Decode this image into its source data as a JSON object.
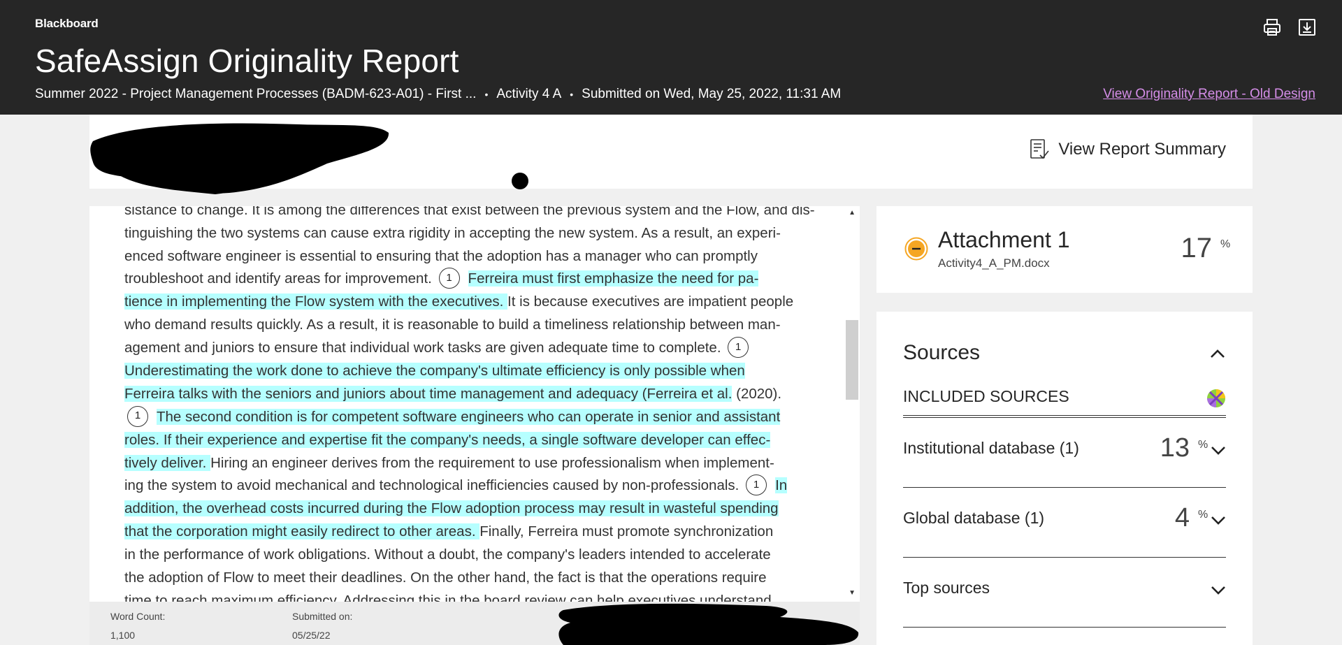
{
  "header": {
    "brand": "Blackboard",
    "title": "SafeAssign Originality Report",
    "course": "Summer 2022 - Project Management Processes (BADM-623-A01) - First ...",
    "activity": "Activity 4 A",
    "submitted": "Submitted on Wed, May 25, 2022, 11:31 AM",
    "old_design_link": "View Originality Report - Old Design",
    "separator": "•"
  },
  "toolbar": {
    "view_summary": "View Report Summary"
  },
  "document": {
    "marker_label": "1",
    "lines": [
      {
        "segments": [
          {
            "text": "sistance to change. It is among the differences that exist between the previous system and the Flow, and dis-",
            "hl": false
          }
        ]
      },
      {
        "segments": [
          {
            "text": "tinguishing the two systems can cause extra rigidity in accepting the new system. As a result, an experi-",
            "hl": false
          }
        ]
      },
      {
        "segments": [
          {
            "text": "enced software engineer is essential to ensuring that the adoption has a manager who can promptly",
            "hl": false
          }
        ]
      },
      {
        "segments": [
          {
            "text": "troubleshoot and identify areas for improvement. ",
            "hl": false
          },
          {
            "marker": true
          },
          {
            "text": "Ferreira must first emphasize the need for pa-",
            "hl": true
          }
        ]
      },
      {
        "segments": [
          {
            "text": "tience in implementing the Flow system with the executives. ",
            "hl": true
          },
          {
            "text": "It is because executives are impatient people",
            "hl": false
          }
        ]
      },
      {
        "segments": [
          {
            "text": "who demand results quickly. As a result, it is reasonable to build a timeliness relationship between man-",
            "hl": false
          }
        ]
      },
      {
        "segments": [
          {
            "text": "agement and juniors to ensure that individual work tasks are given adequate time to complete. ",
            "hl": false
          },
          {
            "marker": true
          }
        ]
      },
      {
        "segments": [
          {
            "text": "Underestimating the work done to achieve the company's ultimate efficiency is only possible when",
            "hl": true
          }
        ]
      },
      {
        "segments": [
          {
            "text": "Ferreira talks with the seniors and juniors about time management and adequacy (Ferreira et al.",
            "hl": true
          },
          {
            "text": " (2020).",
            "hl": false
          }
        ]
      },
      {
        "segments": [
          {
            "marker": true
          },
          {
            "text": "The second condition is for competent software engineers who can operate in senior and assistant",
            "hl": true
          }
        ]
      },
      {
        "segments": [
          {
            "text": "roles. If their experience and expertise fit the company's needs, a single software developer can effec-",
            "hl": true
          }
        ]
      },
      {
        "segments": [
          {
            "text": "tively deliver. ",
            "hl": true
          },
          {
            "text": "Hiring an engineer derives from the requirement to use professionalism when implement-",
            "hl": false
          }
        ]
      },
      {
        "segments": [
          {
            "text": "ing the system to avoid mechanical and technological inefficiencies caused by non-professionals. ",
            "hl": false
          },
          {
            "marker": true
          },
          {
            "text": "In",
            "hl": true
          }
        ]
      },
      {
        "segments": [
          {
            "text": "addition, the overhead costs incurred during the Flow adoption process may result in wasteful spending",
            "hl": true
          }
        ]
      },
      {
        "segments": [
          {
            "text": "that the corporation might easily redirect to other areas. ",
            "hl": true
          },
          {
            "text": "Finally, Ferreira must promote synchronization",
            "hl": false
          }
        ]
      },
      {
        "segments": [
          {
            "text": "in the performance of work obligations. Without a doubt, the company's leaders intended to accelerate",
            "hl": false
          }
        ]
      },
      {
        "segments": [
          {
            "text": "the adoption of Flow to meet their deadlines. On the other hand, the fact is that the operations require",
            "hl": false
          }
        ]
      },
      {
        "segments": [
          {
            "text": "time to reach maximum efficiency. Addressing this in the board review can help executives understand",
            "hl": false
          }
        ]
      }
    ]
  },
  "footer": {
    "word_count_label": "Word Count:",
    "word_count_value": "1,100",
    "submitted_label": "Submitted on:",
    "submitted_value": "05/25/22"
  },
  "attachment": {
    "title": "Attachment 1",
    "filename": "Activity4_A_PM.docx",
    "percent": "17",
    "pct_sign": "%"
  },
  "sources": {
    "title": "Sources",
    "included_label": "INCLUDED SOURCES",
    "rows": [
      {
        "name": "Institutional database (1)",
        "percent": "13"
      },
      {
        "name": "Global database (1)",
        "percent": "4"
      },
      {
        "name": "Top sources",
        "percent": ""
      }
    ]
  },
  "colors": {
    "header_bg": "#262626",
    "highlight": "#b6ffff",
    "link": "#d58ee8",
    "attachment_icon": "#f5a623"
  }
}
